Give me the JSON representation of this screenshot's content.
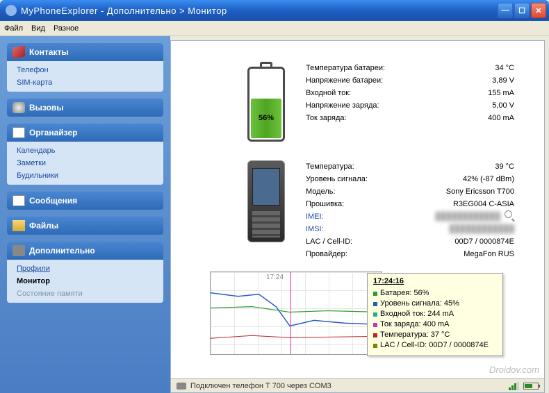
{
  "window": {
    "title": "MyPhoneExplorer  -  Дополнительно > Монитор"
  },
  "menubar": {
    "file": "Файл",
    "view": "Вид",
    "misc": "Разное"
  },
  "sidebar": {
    "contacts": {
      "title": "Контакты",
      "items": [
        "Телефон",
        "SIM-карта"
      ]
    },
    "calls": {
      "title": "Вызовы"
    },
    "organizer": {
      "title": "Органайзер",
      "items": [
        "Календарь",
        "Заметки",
        "Будильники"
      ]
    },
    "messages": {
      "title": "Сообщения"
    },
    "files": {
      "title": "Файлы"
    },
    "extra": {
      "title": "Дополнительно",
      "items": [
        "Профили",
        "Монитор",
        "Состояние памяти"
      ],
      "activeIndex": 1,
      "dimIndex": 2
    }
  },
  "battery": {
    "percent_label": "56%",
    "rows": [
      {
        "k": "Температура батареи:",
        "v": "34 °C"
      },
      {
        "k": "Напряжение батареи:",
        "v": "3,89 V"
      },
      {
        "k": "Входной ток:",
        "v": "155 mA"
      },
      {
        "k": "Напряжение заряда:",
        "v": "5,00 V"
      },
      {
        "k": "Ток заряда:",
        "v": "400 mA"
      }
    ]
  },
  "phone": {
    "rows": [
      {
        "k": "Температура:",
        "v": "39 °C"
      },
      {
        "k": "Уровень сигнала:",
        "v": "42% (-87 dBm)"
      },
      {
        "k": "Модель:",
        "v": "Sony Ericsson T700"
      },
      {
        "k": "Прошивка:",
        "v": "R3EG004 C-ASIA"
      },
      {
        "k": "IMEI:",
        "v": "",
        "blue": true,
        "blurred": true
      },
      {
        "k": "IMSI:",
        "v": "",
        "blue": true,
        "blurred": true
      },
      {
        "k": "LAC / Cell-ID:",
        "v": "00D7 / 0000874E"
      },
      {
        "k": "Провайдер:",
        "v": "MegaFon RUS"
      }
    ]
  },
  "chart_data": {
    "type": "line",
    "x_time_label": "17:24",
    "marker_time": "17:24:16",
    "series": [
      {
        "name": "Батарея",
        "color": "#2a9a2a"
      },
      {
        "name": "Уровень сигнала",
        "color": "#2a5aca"
      },
      {
        "name": "Входной ток",
        "color": "#20b090"
      },
      {
        "name": "Ток заряда",
        "color": "#d030c0"
      },
      {
        "name": "Температура",
        "color": "#c02020"
      },
      {
        "name": "LAC / Cell-ID",
        "color": "#808000"
      }
    ],
    "tooltip": {
      "title": "17:24:16",
      "rows": [
        {
          "color": "#2a9a2a",
          "text": "Батарея: 56%"
        },
        {
          "color": "#2a5aca",
          "text": "Уровень сигнала: 45%"
        },
        {
          "color": "#20b090",
          "text": "Входной ток: 244 mA"
        },
        {
          "color": "#d030c0",
          "text": "Ток заряда: 400 mA"
        },
        {
          "color": "#c02020",
          "text": "Температура: 37 °C"
        },
        {
          "color": "#808000",
          "text": "LAC / Cell-ID: 00D7 / 0000874E"
        }
      ]
    }
  },
  "statusbar": {
    "text": "Подключен телефон T 700 через COM3"
  },
  "watermark": "Droidov.com"
}
